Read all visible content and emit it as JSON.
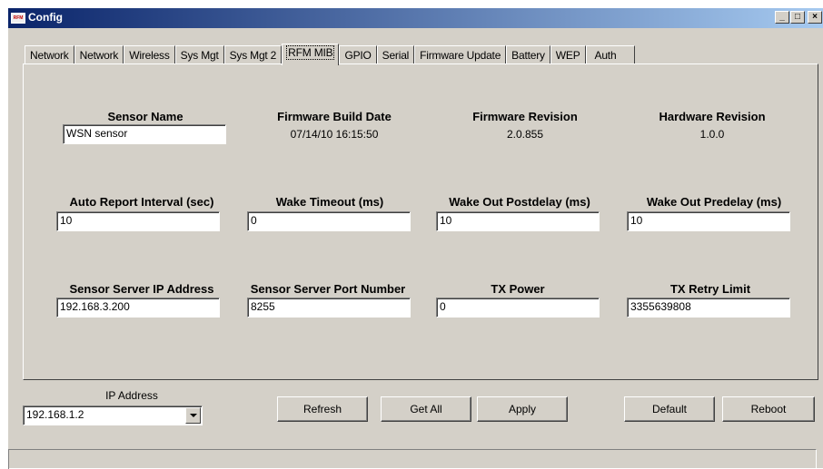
{
  "window": {
    "title": "Config",
    "icon_label": "RFM",
    "minimize": "_",
    "maximize": "□",
    "close": "×"
  },
  "tabs": [
    {
      "label": "Network"
    },
    {
      "label": "Network"
    },
    {
      "label": "Wireless"
    },
    {
      "label": "Sys Mgt"
    },
    {
      "label": "Sys Mgt 2"
    },
    {
      "label": "RFM MIB",
      "active": true
    },
    {
      "label": "GPIO"
    },
    {
      "label": "Serial"
    },
    {
      "label": "Firmware Update"
    },
    {
      "label": "Battery"
    },
    {
      "label": "WEP"
    },
    {
      "label": "Auth"
    }
  ],
  "fields": {
    "sensor_name": {
      "label": "Sensor Name",
      "value": "WSN sensor"
    },
    "firmware_build_date": {
      "label": "Firmware Build Date",
      "value": "07/14/10 16:15:50"
    },
    "firmware_revision": {
      "label": "Firmware Revision",
      "value": "2.0.855"
    },
    "hardware_revision": {
      "label": "Hardware Revision",
      "value": "1.0.0"
    },
    "auto_report_interval": {
      "label": "Auto Report Interval (sec)",
      "value": "10"
    },
    "wake_timeout": {
      "label": "Wake Timeout (ms)",
      "value": "0"
    },
    "wake_out_postdelay": {
      "label": "Wake Out Postdelay (ms)",
      "value": "10"
    },
    "wake_out_predelay": {
      "label": "Wake Out Predelay (ms)",
      "value": "10"
    },
    "sensor_server_ip": {
      "label": "Sensor Server IP Address",
      "value": "192.168.3.200"
    },
    "sensor_server_port": {
      "label": "Sensor Server Port Number",
      "value": "8255"
    },
    "tx_power": {
      "label": "TX Power",
      "value": "0"
    },
    "tx_retry_limit": {
      "label": "TX Retry Limit",
      "value": "3355639808"
    }
  },
  "bottom": {
    "ip_label": "IP Address",
    "ip_value": "192.168.1.2",
    "buttons": {
      "refresh": "Refresh",
      "get_all": "Get All",
      "apply": "Apply",
      "default": "Default",
      "reboot": "Reboot"
    }
  }
}
